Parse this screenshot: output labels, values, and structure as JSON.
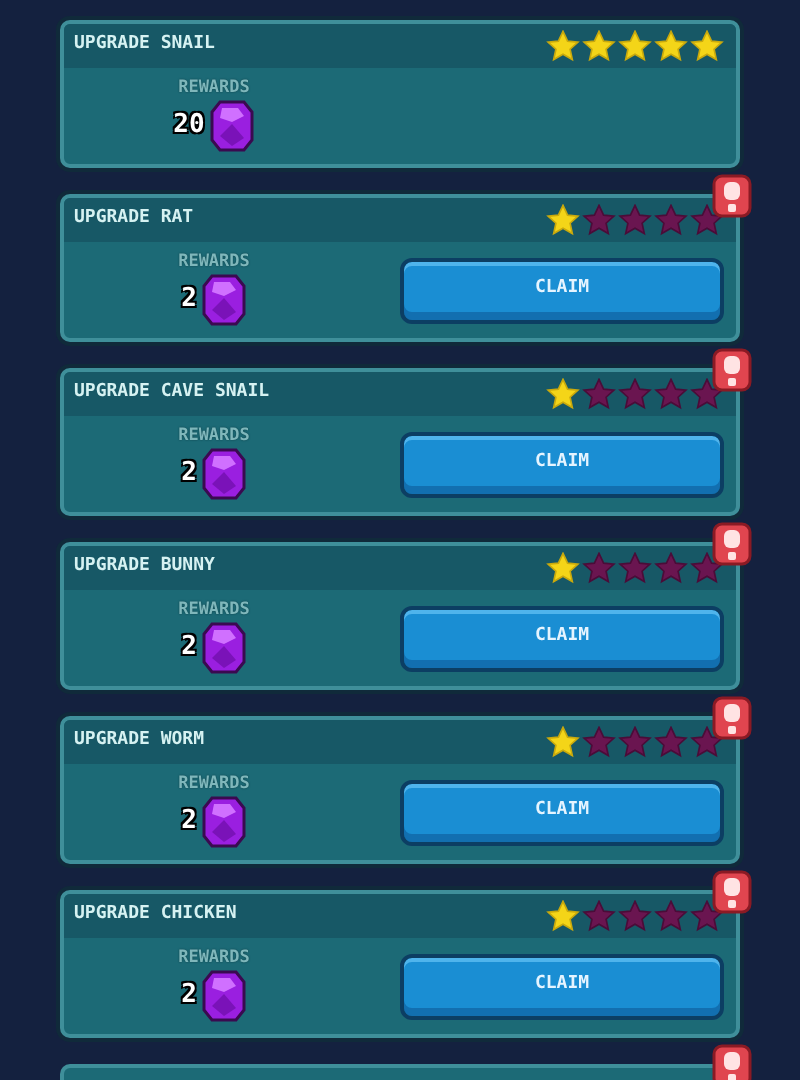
{
  "quests": [
    {
      "title": "UPGRADE SNAIL",
      "stars": 5,
      "alert": false,
      "rewards_label": "REWARDS",
      "reward_amount": "20",
      "claimable": false
    },
    {
      "title": "UPGRADE RAT",
      "stars": 1,
      "alert": true,
      "rewards_label": "REWARDS",
      "reward_amount": "2",
      "claimable": true,
      "button": "CLAIM"
    },
    {
      "title": "UPGRADE CAVE SNAIL",
      "stars": 1,
      "alert": true,
      "rewards_label": "REWARDS",
      "reward_amount": "2",
      "claimable": true,
      "button": "CLAIM"
    },
    {
      "title": "UPGRADE BUNNY",
      "stars": 1,
      "alert": true,
      "rewards_label": "REWARDS",
      "reward_amount": "2",
      "claimable": true,
      "button": "CLAIM"
    },
    {
      "title": "UPGRADE WORM",
      "stars": 1,
      "alert": true,
      "rewards_label": "REWARDS",
      "reward_amount": "2",
      "claimable": true,
      "button": "CLAIM"
    },
    {
      "title": "UPGRADE CHICKEN",
      "stars": 1,
      "alert": true,
      "rewards_label": "REWARDS",
      "reward_amount": "2",
      "claimable": true,
      "button": "CLAIM"
    },
    {
      "alert": true,
      "partial": true
    }
  ]
}
